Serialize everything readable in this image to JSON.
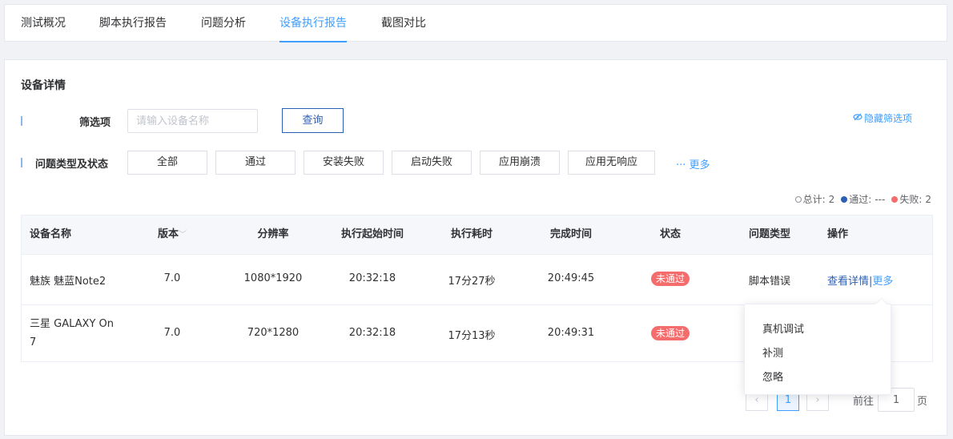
{
  "tabs": [
    {
      "label": "测试概况"
    },
    {
      "label": "脚本执行报告"
    },
    {
      "label": "问题分析"
    },
    {
      "label": "设备执行报告"
    },
    {
      "label": "截图对比"
    }
  ],
  "section_title": "设备详情",
  "filter": {
    "label": "筛选项",
    "placeholder": "请输入设备名称",
    "query_button": "查询",
    "hide_filter": "隐藏筛选项"
  },
  "problem_filter": {
    "label": "问题类型及状态",
    "chips": [
      "全部",
      "通过",
      "安装失败",
      "启动失败",
      "应用崩溃",
      "应用无响应"
    ],
    "more": "··· 更多"
  },
  "summary": {
    "total_label": "总计:",
    "total": "2",
    "pass_label": "通过:",
    "pass": "---",
    "fail_label": "失败:",
    "fail": "2",
    "colors": {
      "total": "#ffffff",
      "pass": "#2b5fb3",
      "fail": "#f56c6c"
    }
  },
  "table": {
    "headers": {
      "device": "设备名称",
      "version": "版本",
      "resolution": "分辨率",
      "start": "执行起始时间",
      "duration": "执行耗时",
      "end": "完成时间",
      "status": "状态",
      "issue": "问题类型",
      "action": "操作"
    },
    "rows": [
      {
        "device": "魅族 魅蓝Note2",
        "version": "7.0",
        "resolution": "1080*1920",
        "start": "20:32:18",
        "duration": "17分27秒",
        "end": "20:49:45",
        "status": "未通过",
        "issue": "脚本错误",
        "detail": "查看详情",
        "sep": "|",
        "more": "更多"
      },
      {
        "device_line1": "三星 GALAXY On",
        "device_line2": "7",
        "version": "7.0",
        "resolution": "720*1280",
        "start": "20:32:18",
        "duration": "17分13秒",
        "end": "20:49:31",
        "status": "未通过"
      }
    ]
  },
  "dropdown": {
    "items": [
      "真机调试",
      "补测",
      "忽略"
    ]
  },
  "pagination": {
    "prev": "‹",
    "current": "1",
    "next": "›",
    "goto_label": "前往",
    "goto_value": "1",
    "page_suffix": "页"
  }
}
